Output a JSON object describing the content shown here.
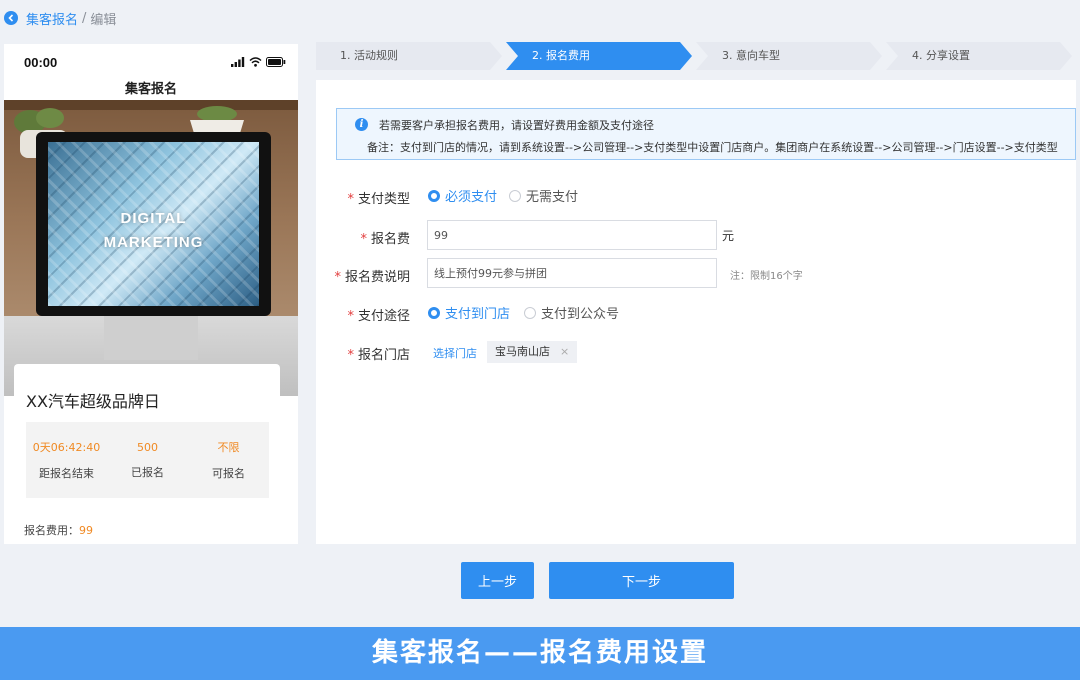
{
  "breadcrumb": {
    "parent": "集客报名",
    "separator": "/",
    "current": "编辑"
  },
  "phone": {
    "time": "00:00",
    "title": "集客报名",
    "hero_text_line1": "DIGITAL",
    "hero_text_line2": "MARKETING",
    "event_title": "XX汽车超级品牌日",
    "stats": [
      {
        "value": "0天06:42:40",
        "label": "距报名结束"
      },
      {
        "value": "500",
        "label": "已报名"
      },
      {
        "value": "不限",
        "label": "可报名"
      }
    ],
    "fee_label": "报名费用：",
    "fee_value": "99"
  },
  "steps": [
    {
      "label": "1. 活动规则",
      "active": false
    },
    {
      "label": "2. 报名费用",
      "active": true
    },
    {
      "label": "3. 意向车型",
      "active": false
    },
    {
      "label": "4. 分享设置",
      "active": false
    }
  ],
  "notice": {
    "line1": "若需要客户承担报名费用，请设置好费用金额及支付途径",
    "line2": "备注：支付到门店的情况，请到系统设置-->公司管理-->支付类型中设置门店商户。集团商户在系统设置-->公司管理-->门店设置-->支付类型"
  },
  "form": {
    "required_mark": "*",
    "pay_type": {
      "label": "支付类型",
      "options": [
        "必须支付",
        "无需支付"
      ],
      "selected": "必须支付"
    },
    "fee": {
      "label": "报名费",
      "value": "99",
      "unit": "元"
    },
    "fee_desc": {
      "label": "报名费说明",
      "value": "线上预付99元参与拼团",
      "hint": "注：限制16个字"
    },
    "pay_channel": {
      "label": "支付途径",
      "options": [
        "支付到门店",
        "支付到公众号"
      ],
      "selected": "支付到门店"
    },
    "store": {
      "label": "报名门店",
      "select_link": "选择门店",
      "tag": "宝马南山店",
      "tag_close": "×"
    }
  },
  "buttons": {
    "prev": "上一步",
    "next": "下一步"
  },
  "banner": "集客报名——报名费用设置",
  "colors": {
    "primary": "#2f8ef0",
    "accent": "#f08a24",
    "banner": "#4a9af1",
    "required": "#e23c3c"
  }
}
